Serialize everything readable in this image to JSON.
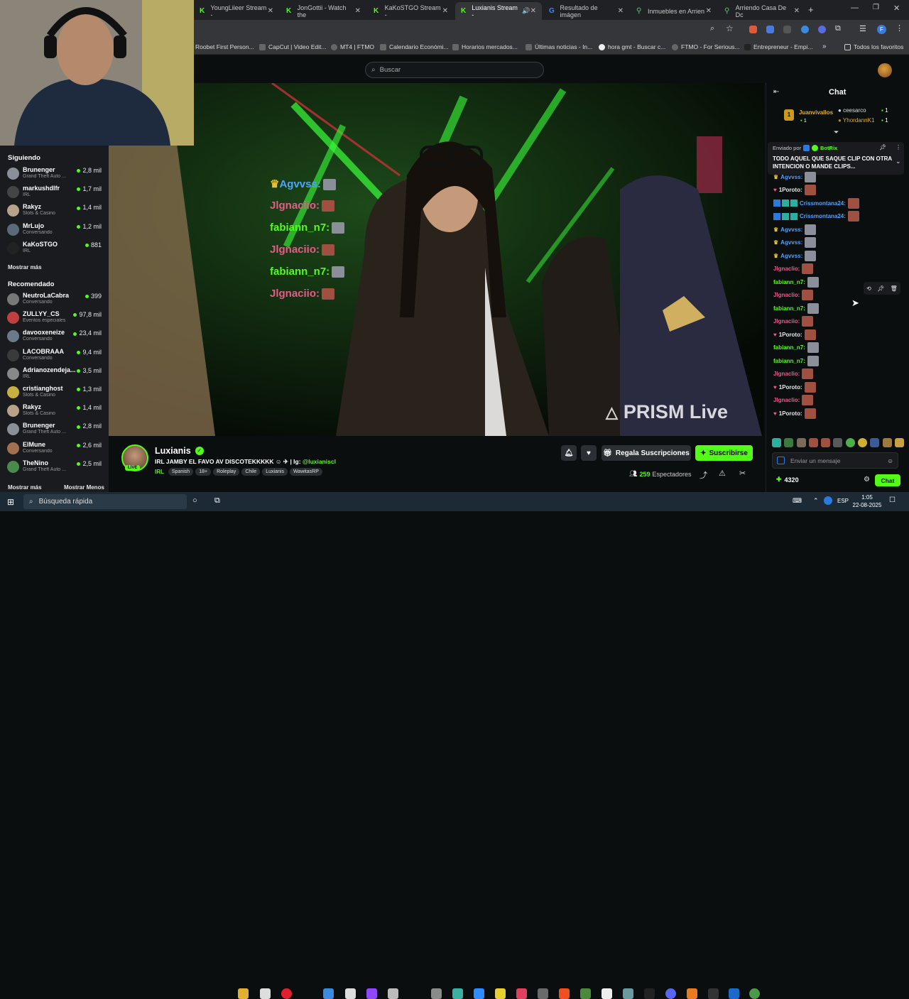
{
  "browser": {
    "tabs": [
      {
        "label": "YoungLiieer Stream -",
        "active": false
      },
      {
        "label": "JonGottii - Watch the",
        "active": false
      },
      {
        "label": "KaKoSTGO Stream - ",
        "active": false
      },
      {
        "label": "Luxianis Stream -",
        "active": true
      },
      {
        "label": "Resultado de imágen",
        "active": false
      },
      {
        "label": "Inmuebles en Arrien",
        "active": false
      },
      {
        "label": "Arriendo Casa De Dc",
        "active": false
      }
    ],
    "bookmarks": [
      "Roobet First Person...",
      "CapCut | Video Edit...",
      "MT4 | FTMO",
      "Calendario Económi...",
      "Horarios mercados...",
      "Últimas noticias - In...",
      "hora gmt - Buscar c...",
      "FTMO - For Serious...",
      "Entrepreneur - Empi..."
    ],
    "all_bookmarks": "Todos los favoritos"
  },
  "header": {
    "search_placeholder": "Buscar"
  },
  "sidebar": {
    "following_title": "Siguiendo",
    "following": [
      {
        "name": "Brunenger",
        "game": "Grand Theft Auto ...",
        "viewers": "2,8 mil",
        "color": "#8a8f9a"
      },
      {
        "name": "markushdlfr",
        "game": "IRL",
        "viewers": "1,7 mil",
        "color": "#444"
      },
      {
        "name": "Rakyz",
        "game": "Slots & Casino",
        "viewers": "1,4 mil",
        "color": "#b9a28a"
      },
      {
        "name": "MrLujo",
        "game": "Conversando",
        "viewers": "1,2 mil",
        "color": "#5a6a7a"
      },
      {
        "name": "KaKoSTGO",
        "game": "IRL",
        "viewers": "881",
        "color": "#222"
      }
    ],
    "following_more": "Mostrar más",
    "recommended_title": "Recomendado",
    "recommended": [
      {
        "name": "NeutroLaCabra",
        "game": "Conversando",
        "viewers": "399",
        "color": "#777"
      },
      {
        "name": "ZULLYY_CS",
        "game": "Eventos especiales",
        "viewers": "97,8 mil",
        "color": "#c04040"
      },
      {
        "name": "davooxeneize",
        "game": "Conversando",
        "viewers": "23,4 mil",
        "color": "#6a7a8a"
      },
      {
        "name": "LACOBRAAA",
        "game": "Conversando",
        "viewers": "9,4 mil",
        "color": "#3a3a3a"
      },
      {
        "name": "Adrianozendeja...",
        "game": "IRL",
        "viewers": "3,5 mil",
        "color": "#888"
      },
      {
        "name": "cristianghost",
        "game": "Slots & Casino",
        "viewers": "1,3 mil",
        "color": "#c8b040"
      },
      {
        "name": "Rakyz",
        "game": "Slots & Casino",
        "viewers": "1,4 mil",
        "color": "#b9a28a"
      },
      {
        "name": "Brunenger",
        "game": "Grand Theft Auto ...",
        "viewers": "2,8 mil",
        "color": "#8a8f9a"
      },
      {
        "name": "ElMune",
        "game": "Conversando",
        "viewers": "2,6 mil",
        "color": "#a07050"
      },
      {
        "name": "TheNino",
        "game": "Grand Theft Auto ...",
        "viewers": "2,5 mil",
        "color": "#4a8a4a"
      }
    ],
    "show_more": "Mostrar más",
    "show_less": "Mostrar Menos"
  },
  "video_overlay": {
    "chat": [
      {
        "user": "Agvvss:",
        "color": "#4da3ff",
        "crown": true
      },
      {
        "user": "Jlgnaclio:",
        "color": "#e85a8a",
        "crown": false
      },
      {
        "user": "fabiann_n7:",
        "color": "#53fc18",
        "crown": false
      },
      {
        "user": "Jlgnaciio:",
        "color": "#e85a8a",
        "crown": false
      },
      {
        "user": "fabiann_n7:",
        "color": "#53fc18",
        "crown": false
      },
      {
        "user": "Jlgnaciio:",
        "color": "#e85a8a",
        "crown": false
      }
    ],
    "watermark": "PRISM Live"
  },
  "stream": {
    "streamer": "Luxianis",
    "live_badge": "LIVE",
    "title_prefix": "IRL JAMBY EL FAVO AV DISCOTEKKKKK",
    "title_ig": "| Ig:",
    "title_handle": "@luxianiscl",
    "category": "IRL",
    "tags": [
      "Spanish",
      "18+",
      "Roleplay",
      "Chile",
      "Luxianis",
      "WawitasRP"
    ],
    "gift_label": "Regala Suscripciones",
    "subscribe_label": "Suscribirse",
    "viewers": "259",
    "viewers_label": "Espectadores"
  },
  "chat": {
    "title": "Chat",
    "leaderboard": [
      {
        "rank": "1",
        "name": "Juanvivallos",
        "count": "1"
      },
      {
        "name": "ceesarco",
        "count": "1"
      },
      {
        "name": "YhordannK1",
        "count": "1"
      }
    ],
    "pinned_sent_by": "Enviado por",
    "pinned_author": "BotRix",
    "pinned_text": "TODO AQUEL QUE SAQUE CLIP CON OTRA INTENCION O MANDE CLIPS...",
    "messages": [
      {
        "user": "Agvvss:",
        "color": "#4da3ff",
        "emote": "#8a8f99"
      },
      {
        "user": "1Poroto:",
        "color": "#e8e8e8",
        "emote": "#a05040"
      },
      {
        "user": "Crissmontana24:",
        "color": "#4da3ff",
        "emote": "#a05040"
      },
      {
        "user": "Crissmontana24:",
        "color": "#4da3ff",
        "emote": "#a05040"
      },
      {
        "user": "Agvvss:",
        "color": "#4da3ff",
        "emote": "#8a8f99"
      },
      {
        "user": "Agvvss:",
        "color": "#4da3ff",
        "emote": "#8a8f99"
      },
      {
        "user": "Agvvss:",
        "color": "#4da3ff",
        "emote": "#8a8f99"
      },
      {
        "user": "Jlgnaclio:",
        "color": "#e85a8a",
        "emote": "#a05040"
      },
      {
        "user": "fabiann_n7:",
        "color": "#53fc18",
        "emote": "#8a8f99"
      },
      {
        "user": "Jlgnaclio:",
        "color": "#e85a8a",
        "emote": "#a05040"
      },
      {
        "user": "fabiann_n7:",
        "color": "#53fc18",
        "emote": "#8a8f99"
      },
      {
        "user": "Jlgnaciio:",
        "color": "#e85a8a",
        "emote": "#a05040"
      },
      {
        "user": "1Poroto:",
        "color": "#e8e8e8",
        "emote": "#a05040"
      },
      {
        "user": "fabiann_n7:",
        "color": "#53fc18",
        "emote": "#8a8f99"
      },
      {
        "user": "fabiann_n7:",
        "color": "#53fc18",
        "emote": "#8a8f99"
      },
      {
        "user": "Jlgnaclio:",
        "color": "#e85a8a",
        "emote": "#a05040"
      },
      {
        "user": "1Poroto:",
        "color": "#e8e8e8",
        "emote": "#a05040"
      },
      {
        "user": "Jlgnaclio:",
        "color": "#e85a8a",
        "emote": "#a05040"
      },
      {
        "user": "1Poroto:",
        "color": "#e8e8e8",
        "emote": "#a05040"
      }
    ],
    "input_placeholder": "Enviar un mensaje",
    "points": "4320",
    "send_label": "Chat"
  },
  "taskbar": {
    "search_placeholder": "Búsqueda rápida",
    "lang": "ESP",
    "time": "1:05",
    "date": "22-08-2025"
  },
  "colors": {
    "kick_green": "#53fc18",
    "background": "#0b0e0f"
  }
}
